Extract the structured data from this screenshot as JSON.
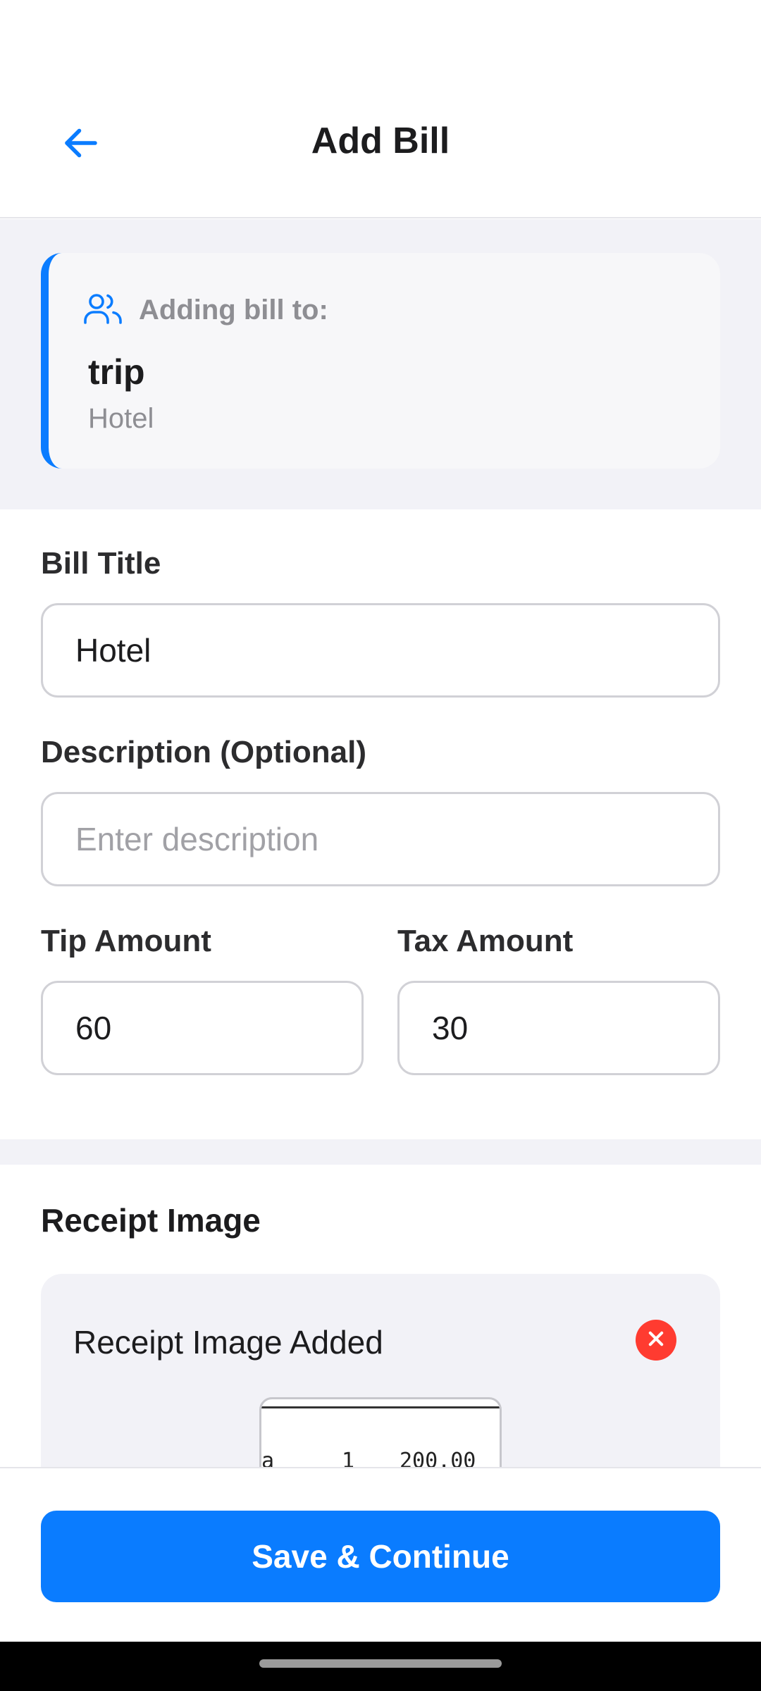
{
  "header": {
    "title": "Add Bill",
    "back_icon": "arrow-left-icon"
  },
  "group_banner": {
    "icon": "users-icon",
    "label": "Adding bill to:",
    "group_name": "trip",
    "bill_name": "Hotel"
  },
  "form": {
    "bill_title": {
      "label": "Bill Title",
      "value": "Hotel"
    },
    "description": {
      "label": "Description (Optional)",
      "value": "",
      "placeholder": "Enter description"
    },
    "tip": {
      "label": "Tip Amount",
      "value": "60"
    },
    "tax": {
      "label": "Tax Amount",
      "value": "30"
    }
  },
  "receipt": {
    "section_title": "Receipt Image",
    "status": "Receipt Image Added",
    "remove_icon": "close-icon",
    "preview_row": {
      "c1": "a",
      "c2": "1",
      "c3": "200.00"
    }
  },
  "footer": {
    "save_label": "Save & Continue"
  },
  "colors": {
    "accent": "#0a7cff",
    "danger": "#ff3b30",
    "muted": "#8e8e93"
  }
}
